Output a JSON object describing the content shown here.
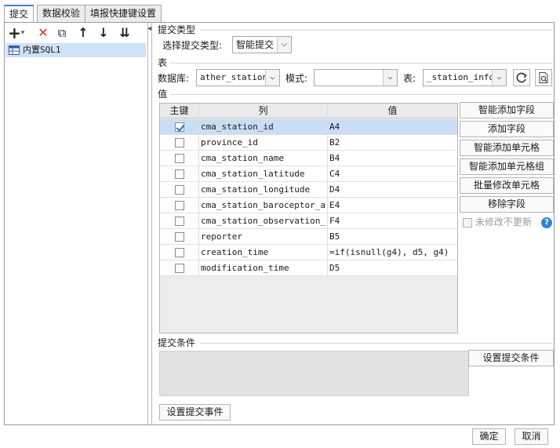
{
  "tabs": [
    {
      "label": "提交"
    },
    {
      "label": "数据校验"
    },
    {
      "label": "填报快捷键设置"
    }
  ],
  "left_toolbar": {
    "add_glyph": "+",
    "dropdown_glyph": "▾",
    "delete_glyph": "✕",
    "copy_glyph": "⧉",
    "up_glyph": "↑",
    "down_glyph": "↓",
    "sort_glyph": "⇊",
    "collapse_glyph": "◂"
  },
  "tree": {
    "items": [
      {
        "label": "内置SQL1",
        "icon": "sql-table-icon"
      }
    ]
  },
  "submit_type": {
    "section_title": "提交类型",
    "label": "选择提交类型:",
    "value": "智能提交"
  },
  "table_section": {
    "section_title": "表",
    "db_label": "数据库:",
    "db_value": "ather_station",
    "schema_label": "模式:",
    "schema_value": "",
    "table_label": "表:",
    "table_value": "_station_info",
    "refresh_icon": "refresh-icon",
    "preview_icon": "preview-icon"
  },
  "values_section": {
    "section_title": "值",
    "columns": [
      "主键",
      "列",
      "值"
    ],
    "rows": [
      {
        "key": true,
        "col": "cma_station_id",
        "val": "A4"
      },
      {
        "key": false,
        "col": "province_id",
        "val": "B2"
      },
      {
        "key": false,
        "col": "cma_station_name",
        "val": "B4"
      },
      {
        "key": false,
        "col": "cma_station_latitude",
        "val": "C4"
      },
      {
        "key": false,
        "col": "cma_station_longitude",
        "val": "D4"
      },
      {
        "key": false,
        "col": "cma_station_baroceptor_a...",
        "val": "E4"
      },
      {
        "key": false,
        "col": "cma_station_observation_...",
        "val": "F4"
      },
      {
        "key": false,
        "col": "reporter",
        "val": "B5"
      },
      {
        "key": false,
        "col": "creation_time",
        "val": "=if(isnull(g4), d5, g4)"
      },
      {
        "key": false,
        "col": "modification_time",
        "val": "D5"
      }
    ],
    "buttons": {
      "smart_add_field": "智能添加字段",
      "add_field": "添加字段",
      "smart_add_cell": "智能添加单元格",
      "smart_add_cell_group": "智能添加单元格组",
      "batch_modify_cell": "批量修改单元格",
      "remove_field": "移除字段"
    },
    "no_update_label": "未修改不更新",
    "no_update_checked": false
  },
  "condition_section": {
    "section_title": "提交条件",
    "set_condition_button": "设置提交条件",
    "set_event_button": "设置提交事件"
  },
  "footer": {
    "ok": "确定",
    "cancel": "取消"
  },
  "colors": {
    "accent": "#3c7fd8",
    "selection": "#c9def3",
    "help": "#2f86d6"
  }
}
